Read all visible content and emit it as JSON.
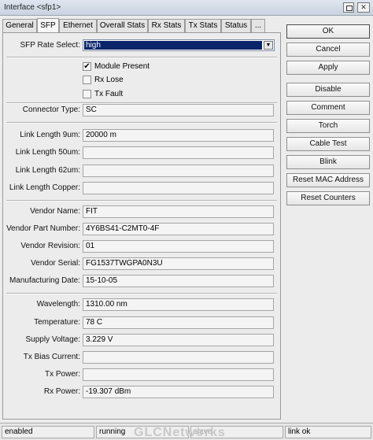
{
  "window": {
    "title": "Interface <sfp1>",
    "close_glyph": "✕"
  },
  "tabs": [
    {
      "label": "General"
    },
    {
      "label": "SFP"
    },
    {
      "label": "Ethernet"
    },
    {
      "label": "Overall Stats"
    },
    {
      "label": "Rx Stats"
    },
    {
      "label": "Tx Stats"
    },
    {
      "label": "Status"
    },
    {
      "label": "..."
    }
  ],
  "sfp": {
    "rate_select_label": "SFP Rate Select:",
    "rate_select_value": "high",
    "module_present": {
      "label": "Module Present",
      "checked": true,
      "glyph": "✔"
    },
    "rx_lose": {
      "label": "Rx Lose",
      "checked": false
    },
    "tx_fault": {
      "label": "Tx Fault",
      "checked": false
    },
    "fields": [
      {
        "label": "Connector Type:",
        "value": "SC"
      },
      {
        "label": "Link Length 9um:",
        "value": "20000 m"
      },
      {
        "label": "Link Length 50um:",
        "value": ""
      },
      {
        "label": "Link Length 62um:",
        "value": ""
      },
      {
        "label": "Link Length Copper:",
        "value": ""
      },
      {
        "label": "Vendor Name:",
        "value": "FIT"
      },
      {
        "label": "Vendor Part Number:",
        "value": "4Y6BS41-C2MT0-4F"
      },
      {
        "label": "Vendor Revision:",
        "value": "01"
      },
      {
        "label": "Vendor Serial:",
        "value": "FG1537TWGPA0N3U"
      },
      {
        "label": "Manufacturing Date:",
        "value": "15-10-05"
      },
      {
        "label": "Wavelength:",
        "value": "1310.00 nm"
      },
      {
        "label": "Temperature:",
        "value": "78 C"
      },
      {
        "label": "Supply Voltage:",
        "value": "3.229 V"
      },
      {
        "label": "Tx Bias Current:",
        "value": ""
      },
      {
        "label": "Tx Power:",
        "value": ""
      },
      {
        "label": "Rx Power:",
        "value": "-19.307 dBm"
      }
    ]
  },
  "buttons": {
    "ok": "OK",
    "cancel": "Cancel",
    "apply": "Apply",
    "disable": "Disable",
    "comment": "Comment",
    "torch": "Torch",
    "cable_test": "Cable Test",
    "blink": "Blink",
    "reset_mac": "Reset MAC Address",
    "reset_counters": "Reset Counters"
  },
  "status": {
    "enabled": "enabled",
    "running": "running",
    "slave": "slave",
    "link": "link ok"
  },
  "watermark": "GLCNetworks"
}
